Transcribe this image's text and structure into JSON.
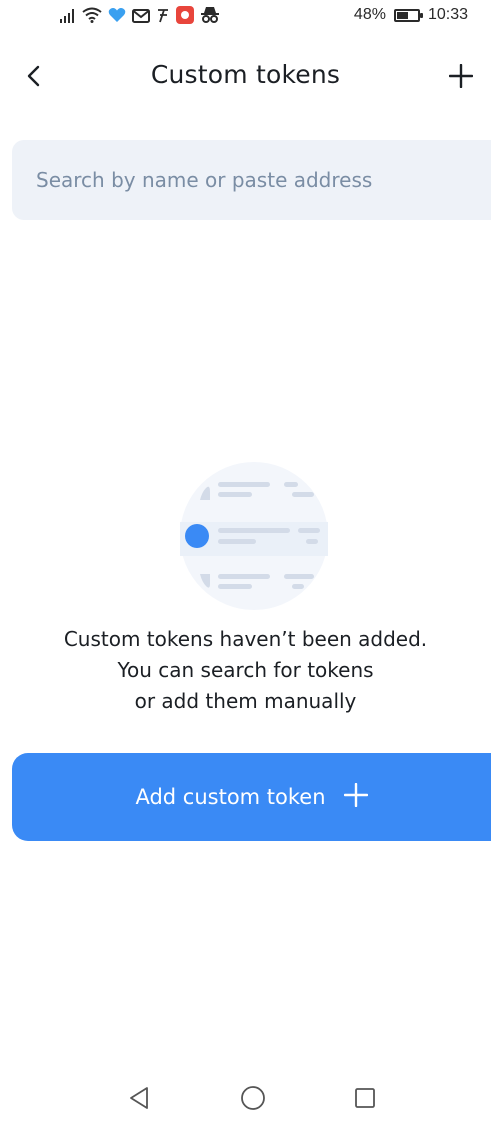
{
  "status_bar": {
    "battery": "48%",
    "time": "10:33",
    "battery_level": 0.48,
    "left_icons": [
      "signal-icon",
      "wifi-icon",
      "heart-app-icon",
      "mail-icon",
      "app-glyph-icon",
      "red-app-icon",
      "incognito-icon"
    ]
  },
  "header": {
    "title": "Custom tokens",
    "back_icon": "chevron-left-icon",
    "add_icon": "plus-icon"
  },
  "search": {
    "placeholder": "Search by name or paste address",
    "value": ""
  },
  "empty_state": {
    "illustration_icon": "empty-token-list-icon",
    "line1": "Custom tokens haven’t been added.",
    "line2": "You can search for tokens",
    "line3": "or add them manually"
  },
  "primary_button": {
    "label": "Add custom token",
    "icon": "plus-icon"
  },
  "nav_bar": {
    "icons": [
      "back-triangle-icon",
      "home-circle-icon",
      "recents-square-icon"
    ]
  },
  "colors": {
    "accent": "#3a8af5",
    "search_bg": "#eef2f8",
    "placeholder": "#7a8da4",
    "text": "#1b1f24"
  }
}
